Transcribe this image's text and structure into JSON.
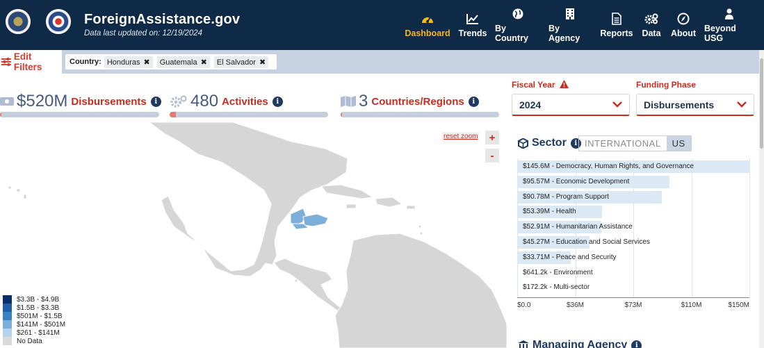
{
  "header": {
    "title": "ForeignAssistance.gov",
    "subtitle": "Data last updated on: 12/19/2024",
    "nav": [
      {
        "label": "Dashboard",
        "icon": "gauge-icon",
        "active": true
      },
      {
        "label": "Trends",
        "icon": "trend-line-icon",
        "active": false
      },
      {
        "label": "By Country",
        "icon": "globe-icon",
        "active": false
      },
      {
        "label": "By Agency",
        "icon": "building-icon",
        "active": false
      },
      {
        "label": "Reports",
        "icon": "document-icon",
        "active": false
      },
      {
        "label": "Data",
        "icon": "gears-icon",
        "active": false
      },
      {
        "label": "About",
        "icon": "compass-icon",
        "active": false
      },
      {
        "label": "Beyond USG",
        "icon": "person-icon",
        "active": false
      }
    ]
  },
  "filters": {
    "edit_label": "Edit Filters",
    "country_label": "Country:",
    "chips": [
      "Honduras",
      "Guatemala",
      "El Salvador"
    ],
    "remove_glyph": "✖"
  },
  "stats": {
    "disbursements": {
      "value": "$520M",
      "label": "Disbursements",
      "progress": 0.01
    },
    "activities": {
      "value": "480",
      "label": "Activities",
      "progress": 0.04
    },
    "countries": {
      "value": "3",
      "label": "Countries/Regions",
      "progress": 0.01
    }
  },
  "fiscal_year": {
    "label": "Fiscal Year",
    "value": "2024"
  },
  "funding_phase": {
    "label": "Funding Phase",
    "value": "Disbursements"
  },
  "map": {
    "reset_label": "reset zoom",
    "zoom_in": "+",
    "zoom_out": "-",
    "legend": [
      {
        "label": "$3.3B - $4.9B",
        "color": "#08306b"
      },
      {
        "label": "$1.5B - $3.3B",
        "color": "#1f5fa8"
      },
      {
        "label": "$501M - $1.5B",
        "color": "#3b82c4"
      },
      {
        "label": "$141M - $501M",
        "color": "#7bafd9"
      },
      {
        "label": "$261 - $141M",
        "color": "#b4d2ec"
      },
      {
        "label": "No Data",
        "color": "#d9d9d9"
      }
    ],
    "highlight_color": "#7bafd9",
    "land_color": "#d6d6d6"
  },
  "sector": {
    "title": "Sector",
    "toggle": [
      "INTERNATIONAL",
      "US"
    ],
    "active_toggle": "US"
  },
  "chart_data": {
    "type": "bar",
    "orientation": "horizontal",
    "categories": [
      "$145.6M - Democracy, Human Rights, and Governance",
      "$95.57M - Economic Development",
      "$90.78M - Program Support",
      "$53.39M - Health",
      "$52.91M - Humanitarian Assistance",
      "$45.27M - Education and Social Services",
      "$33.71M - Peace and Security",
      "$641.2k - Environment",
      "$172.2k - Multi-sector"
    ],
    "values": [
      145.6,
      95.57,
      90.78,
      53.39,
      52.91,
      45.27,
      33.71,
      0.6412,
      0.1722
    ],
    "xlim": [
      0,
      145.6
    ],
    "ticks": [
      {
        "label": "$0.0",
        "value": 0
      },
      {
        "label": "$36M",
        "value": 36.4
      },
      {
        "label": "$73M",
        "value": 72.8
      },
      {
        "label": "$110M",
        "value": 109.2
      },
      {
        "label": "$150M",
        "value": 145.6
      }
    ],
    "bar_color": "#dbe9f4"
  },
  "managing_agency": {
    "title": "Managing Agency"
  }
}
